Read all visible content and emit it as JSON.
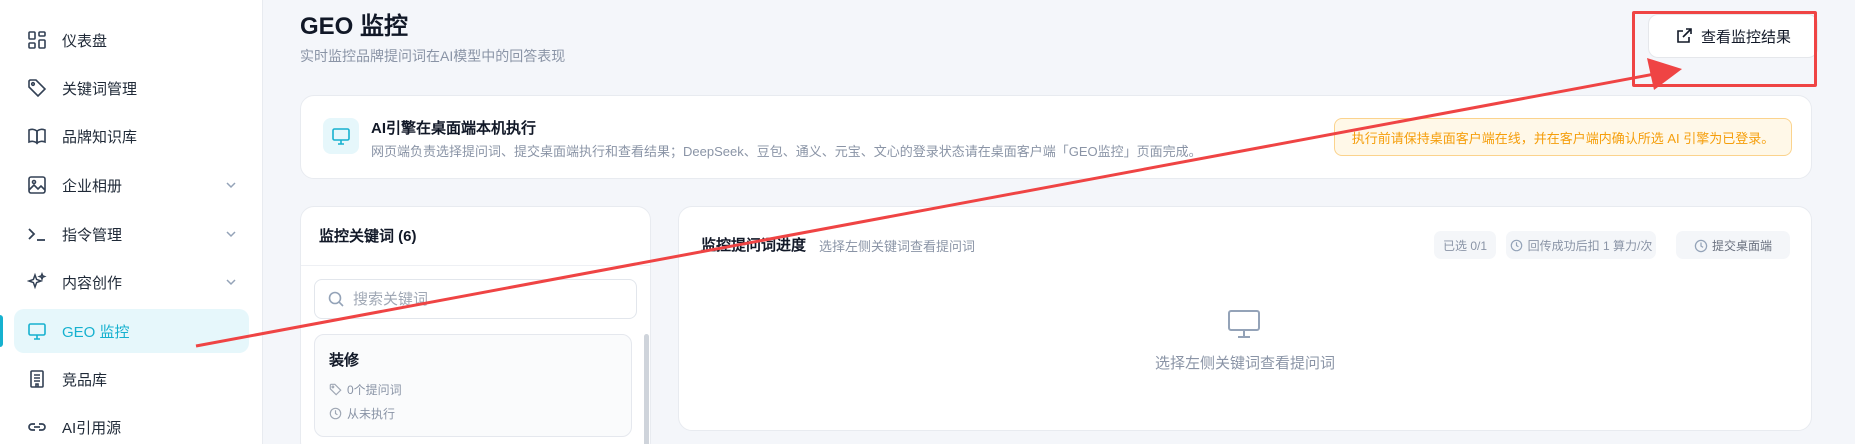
{
  "sidebar": {
    "items": [
      {
        "label": "仪表盘",
        "icon": "dashboard-icon"
      },
      {
        "label": "关键词管理",
        "icon": "tag-icon"
      },
      {
        "label": "品牌知识库",
        "icon": "book-icon"
      },
      {
        "label": "企业相册",
        "icon": "image-icon",
        "expandable": true
      },
      {
        "label": "指令管理",
        "icon": "terminal-icon",
        "expandable": true
      },
      {
        "label": "内容创作",
        "icon": "sparkle-icon",
        "expandable": true
      },
      {
        "label": "GEO 监控",
        "icon": "monitor-icon",
        "active": true
      },
      {
        "label": "竞品库",
        "icon": "building-icon"
      },
      {
        "label": "AI引用源",
        "icon": "link-icon"
      }
    ]
  },
  "header": {
    "title": "GEO 监控",
    "subtitle": "实时监控品牌提问词在AI模型中的回答表现",
    "view_button": "查看监控结果"
  },
  "info_card": {
    "title": "AI引擎在桌面端本机执行",
    "description": "网页端负责选择提问词、提交桌面端执行和查看结果；DeepSeek、豆包、通义、元宝、文心的登录状态请在桌面客户端「GEO监控」页面完成。",
    "warning": "执行前请保持桌面客户端在线，并在客户端内确认所选 AI 引擎为已登录。"
  },
  "keywords_panel": {
    "title": "监控关键词 (6)",
    "search_placeholder": "搜索关键词",
    "items": [
      {
        "name": "装修",
        "prompt_count": "0个提问词",
        "last_run": "从未执行"
      }
    ]
  },
  "progress_panel": {
    "title": "监控提问词进度",
    "hint": "选择左侧关键词查看提问词",
    "selected_badge": "已选 0/1",
    "cost_badge": "回传成功后扣 1 算力/次",
    "submit_button": "提交桌面端",
    "empty_text": "选择左侧关键词查看提问词"
  },
  "colors": {
    "accent": "#16b1cf",
    "warning": "#f59e0b",
    "annotation": "#ef4444"
  }
}
